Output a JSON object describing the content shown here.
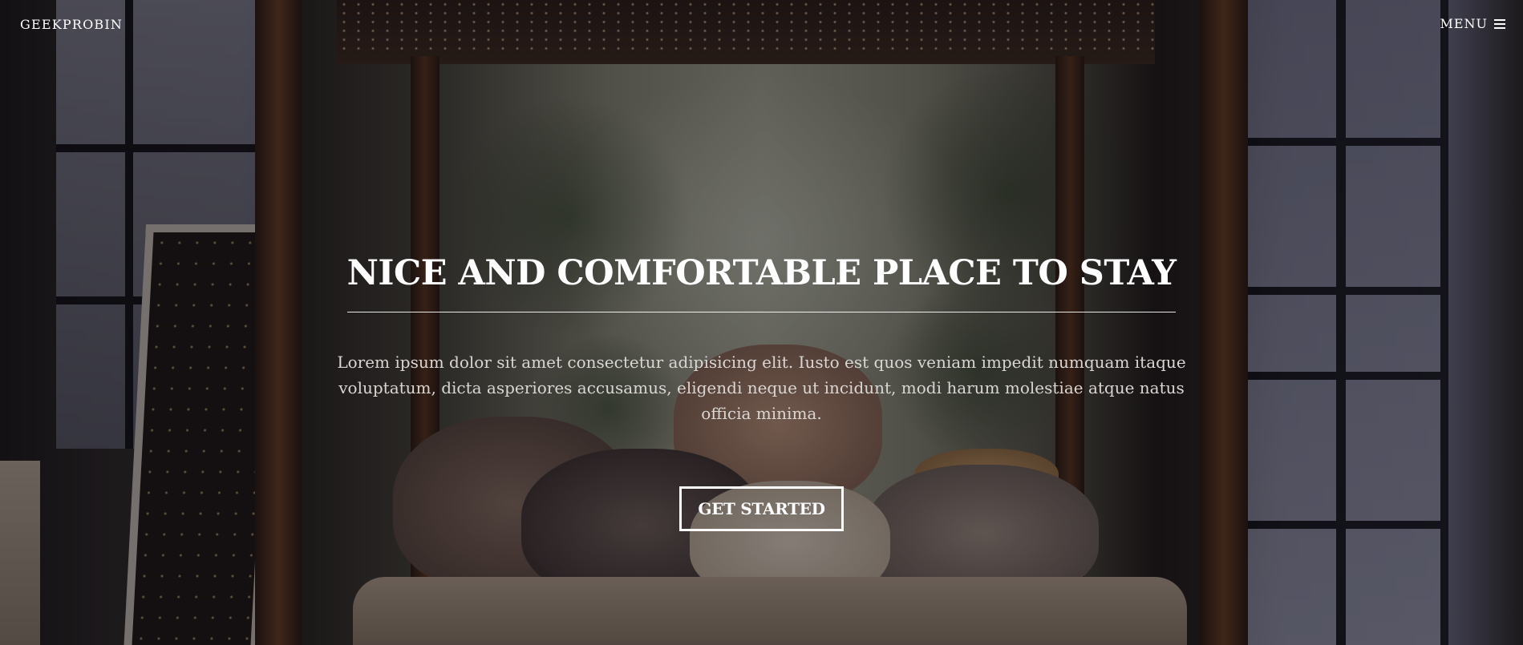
{
  "header": {
    "brand": "GEEKPROBIN",
    "menu_label": "MENU",
    "menu_icon": "hamburger-icon"
  },
  "hero": {
    "title": "NICE AND COMFORTABLE PLACE TO STAY",
    "description": "Lorem ipsum dolor sit amet consectetur adipisicing elit. Iusto est quos veniam impedit numquam itaque voluptatum, dicta asperiores accusamus, eligendi neque ut incidunt, modi harum molestiae atque natus officia minima.",
    "cta_label": "GET STARTED"
  },
  "colors": {
    "text": "#ffffff",
    "overlay": "#0a0814"
  }
}
